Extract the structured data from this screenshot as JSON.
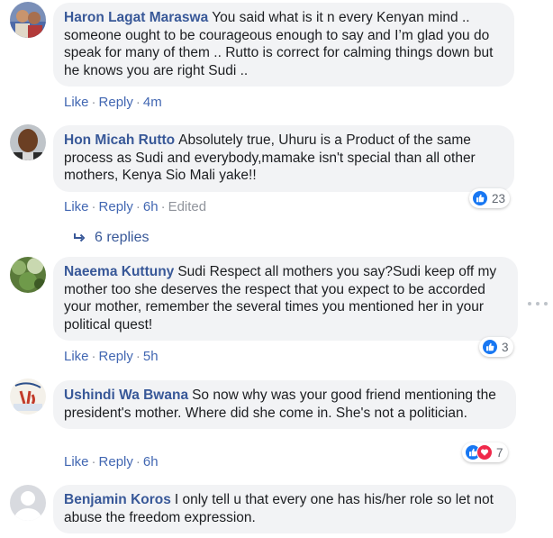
{
  "actions": {
    "like": "Like",
    "reply": "Reply",
    "edited": "Edited"
  },
  "comments": [
    {
      "author": "Haron Lagat Maraswa",
      "text": "You said what is it n every Kenyan mind .. someone ought to be courageous enough to say and I’m glad you do speak for many of them .. Rutto is correct for calming things down but he knows you are right Sudi ..",
      "time": "4m"
    },
    {
      "author": "Hon Micah Rutto",
      "text": "Absolutely true, Uhuru is a Product of the same process as Sudi and everybody,mamake isn't special than all other mothers, Kenya Sio Mali yake!!",
      "time": "6h",
      "reaction_count": "23"
    },
    {
      "author": "Naeema Kuttuny",
      "text": "Sudi Respect all mothers you say?Sudi keep off my mother too she deserves the respect that you expect to be accorded your mother, remember the several times you mentioned her in your political quest!",
      "time": "5h",
      "reaction_count": "3"
    },
    {
      "author": "Ushindi Wa Bwana",
      "text": "So now why was your good friend mentioning the president's mother. Where did she come in. She's not a politician.",
      "time": "6h",
      "reaction_count": "7"
    },
    {
      "author": "Benjamin Koros",
      "text": "I only tell u that every one has his/her role so let not abuse the freedom expression."
    }
  ],
  "replies_label": "6 replies",
  "colors": {
    "author": "#385898",
    "link": "#4267b2",
    "bubble": "#f2f3f5",
    "like": "#1877f2",
    "love": "#f0284a"
  }
}
